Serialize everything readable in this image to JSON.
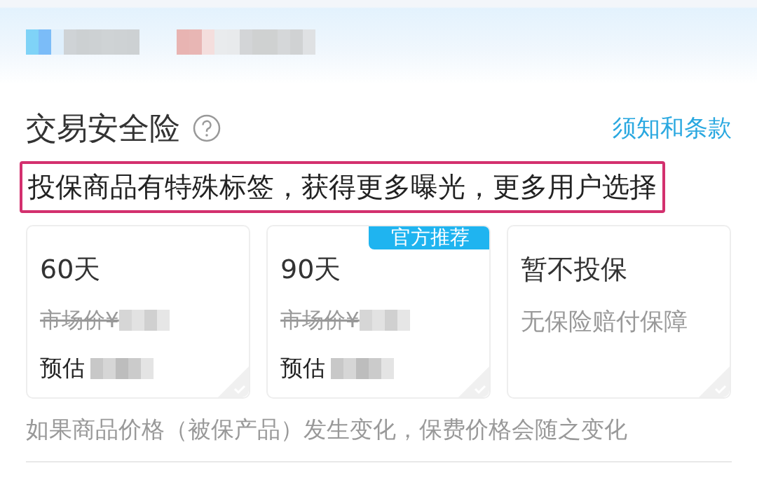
{
  "header": {
    "redacted": true
  },
  "section": {
    "title": "交易安全险",
    "terms_link": "须知和条款"
  },
  "highlight": "投保商品有特殊标签，获得更多曝光，更多用户选择",
  "plans": [
    {
      "kind": "priced",
      "title": "60天",
      "market_price": "市场价¥",
      "estimate": "预估",
      "selected": false
    },
    {
      "kind": "priced",
      "title": "90天",
      "market_price": "市场价¥",
      "estimate": "预估",
      "badge": "官方推荐",
      "selected": false
    },
    {
      "kind": "none",
      "title": "暂不投保",
      "note": "无保险赔付保障",
      "selected": false
    }
  ],
  "footnote": "如果商品价格（被保产品）发生变化，保费价格会随之变化"
}
